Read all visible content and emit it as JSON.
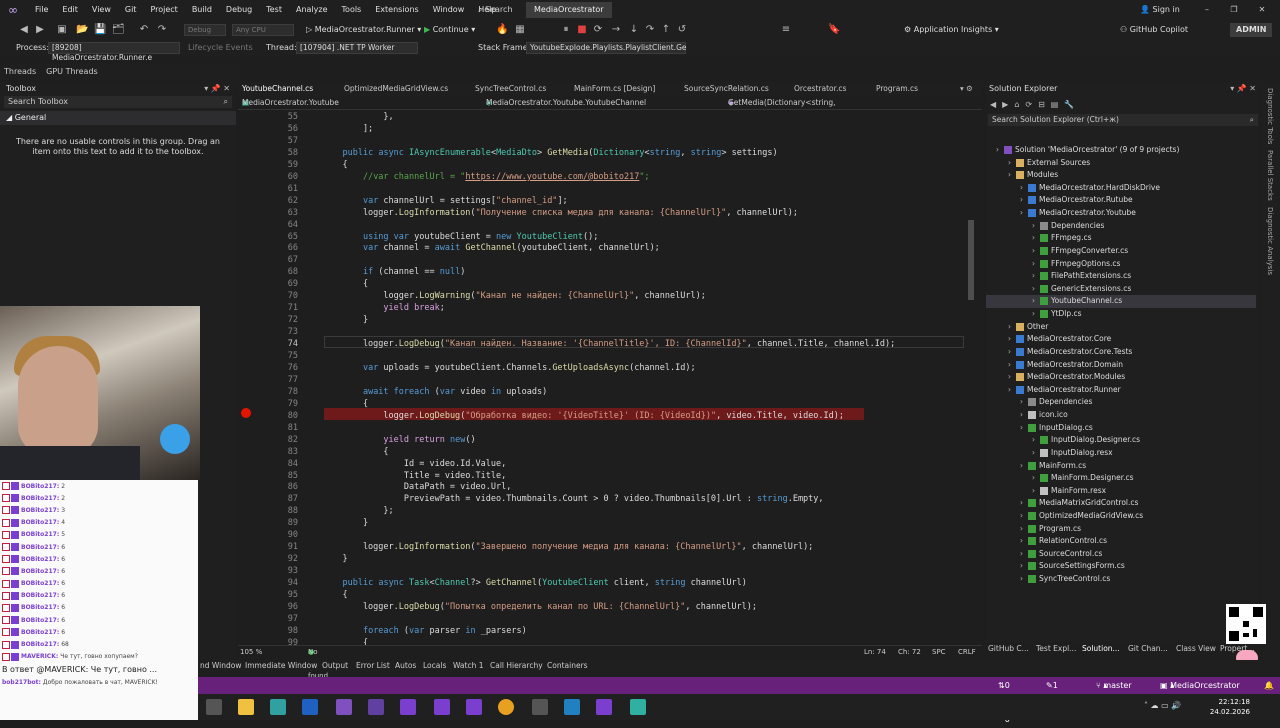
{
  "menu": {
    "items": [
      "File",
      "Edit",
      "View",
      "Git",
      "Project",
      "Build",
      "Debug",
      "Test",
      "Analyze",
      "Tools",
      "Extensions",
      "Window",
      "Help"
    ],
    "search": "Search",
    "project": "MediaOrcestrator",
    "sign_in": "Sign in"
  },
  "toolbar": {
    "config": "Debug",
    "platform": "Any CPU",
    "startup": "MediaOrcestrator.Runner",
    "continue": "Continue",
    "insights": "Application Insights",
    "copilot": "GitHub Copilot",
    "admin": "ADMIN"
  },
  "debugbar": {
    "process_label": "Process:",
    "process": "[89208] MediaOrcestrator.Runner.e",
    "lifecycle": "Lifecycle Events",
    "thread_label": "Thread:",
    "thread": "[107904] .NET TP Worker",
    "stack_label": "Stack Frame:",
    "stack": "YoutubeExplode.Playlists.PlaylistClient.Ge"
  },
  "threads": [
    "Threads",
    "GPU Threads"
  ],
  "toolbox": {
    "title": "Toolbox",
    "search": "Search Toolbox",
    "group": "General",
    "message": "There are no usable controls in this group. Drag an item onto this text to add it to the toolbox."
  },
  "chat": {
    "messages": [
      {
        "user": "BOBito217:",
        "text": "2"
      },
      {
        "user": "BOBito217:",
        "text": "2"
      },
      {
        "user": "BOBito217:",
        "text": "3"
      },
      {
        "user": "BOBito217:",
        "text": "4"
      },
      {
        "user": "BOBito217:",
        "text": "5"
      },
      {
        "user": "BOBito217:",
        "text": "6"
      },
      {
        "user": "BOBito217:",
        "text": "6"
      },
      {
        "user": "BOBito217:",
        "text": "6"
      },
      {
        "user": "BOBito217:",
        "text": "6"
      },
      {
        "user": "BOBito217:",
        "text": "6"
      },
      {
        "user": "BOBito217:",
        "text": "6"
      },
      {
        "user": "BOBito217:",
        "text": "6"
      },
      {
        "user": "BOBito217:",
        "text": "6"
      },
      {
        "user": "BOBito217:",
        "text": "68"
      },
      {
        "user": "MAVERICK:",
        "text": "Че тут, говно хопупаем?"
      }
    ],
    "reply": "В ответ @MAVERICK: Че тут, говно ...",
    "bot_user": "bob217bot:",
    "bot_text": "Добро пожаловать в чат, MAVERICK!"
  },
  "tabs": [
    "YoutubeChannel.cs",
    "OptimizedMediaGridView.cs",
    "SyncTreeControl.cs",
    "MainForm.cs [Design]",
    "SourceSyncRelation.cs",
    "Orcestrator.cs",
    "Program.cs"
  ],
  "navbar": {
    "project": "MediaOrcestrator.Youtube",
    "class": "MediaOrcestrator.Youtube.YoutubeChannel",
    "member": "GetMedia(Dictionary<string, string> settings)"
  },
  "code": [
    {
      "n": "55",
      "t": "            },"
    },
    {
      "n": "56",
      "t": "        ];"
    },
    {
      "n": "57",
      "t": ""
    },
    {
      "n": "58",
      "t": "    public async IAsyncEnumerable<MediaDto> GetMedia(Dictionary<string, string> settings)"
    },
    {
      "n": "59",
      "t": "    {"
    },
    {
      "n": "60",
      "t": "        //var channelUrl = \"https://www.youtube.com/@bobito217\";"
    },
    {
      "n": "61",
      "t": ""
    },
    {
      "n": "62",
      "t": "        var channelUrl = settings[\"channel_id\"];"
    },
    {
      "n": "63",
      "t": "        logger.LogInformation(\"Получение списка медиа для канала: {ChannelUrl}\", channelUrl);"
    },
    {
      "n": "64",
      "t": ""
    },
    {
      "n": "65",
      "t": "        using var youtubeClient = new YoutubeClient();"
    },
    {
      "n": "66",
      "t": "        var channel = await GetChannel(youtubeClient, channelUrl);"
    },
    {
      "n": "67",
      "t": ""
    },
    {
      "n": "68",
      "t": "        if (channel == null)"
    },
    {
      "n": "69",
      "t": "        {"
    },
    {
      "n": "70",
      "t": "            logger.LogWarning(\"Канал не найден: {ChannelUrl}\", channelUrl);"
    },
    {
      "n": "71",
      "t": "            yield break;"
    },
    {
      "n": "72",
      "t": "        }"
    },
    {
      "n": "73",
      "t": ""
    },
    {
      "n": "74",
      "t": "        logger.LogDebug(\"Канал найден. Название: '{ChannelTitle}', ID: {ChannelId}\", channel.Title, channel.Id);"
    },
    {
      "n": "75",
      "t": ""
    },
    {
      "n": "76",
      "t": "        var uploads = youtubeClient.Channels.GetUploadsAsync(channel.Id);"
    },
    {
      "n": "77",
      "t": ""
    },
    {
      "n": "78",
      "t": "        await foreach (var video in uploads)"
    },
    {
      "n": "79",
      "t": "        {"
    },
    {
      "n": "80",
      "t": "            logger.LogDebug(\"Обработка видео: '{VideoTitle}' (ID: {VideoId})\", video.Title, video.Id);"
    },
    {
      "n": "81",
      "t": ""
    },
    {
      "n": "82",
      "t": "            yield return new()"
    },
    {
      "n": "83",
      "t": "            {"
    },
    {
      "n": "84",
      "t": "                Id = video.Id.Value,"
    },
    {
      "n": "85",
      "t": "                Title = video.Title,"
    },
    {
      "n": "86",
      "t": "                DataPath = video.Url,"
    },
    {
      "n": "87",
      "t": "                PreviewPath = video.Thumbnails.Count > 0 ? video.Thumbnails[0].Url : string.Empty,"
    },
    {
      "n": "88",
      "t": "            };"
    },
    {
      "n": "89",
      "t": "        }"
    },
    {
      "n": "90",
      "t": ""
    },
    {
      "n": "91",
      "t": "        logger.LogInformation(\"Завершено получение медиа для канала: {ChannelUrl}\", channelUrl);"
    },
    {
      "n": "92",
      "t": "    }"
    },
    {
      "n": "93",
      "t": ""
    },
    {
      "n": "94",
      "t": "    public async Task<Channel?> GetChannel(YoutubeClient client, string channelUrl)"
    },
    {
      "n": "95",
      "t": "    {"
    },
    {
      "n": "96",
      "t": "        logger.LogDebug(\"Попытка определить канал по URL: {ChannelUrl}\", channelUrl);"
    },
    {
      "n": "97",
      "t": ""
    },
    {
      "n": "98",
      "t": "        foreach (var parser in _parsers)"
    },
    {
      "n": "99",
      "t": "        {"
    }
  ],
  "editor_status": {
    "zoom": "105 %",
    "issues": "No issues found",
    "ln": "Ln: 74",
    "ch": "Ch: 72",
    "spc": "SPC",
    "crlf": "CRLF"
  },
  "solution": {
    "title": "Solution Explorer",
    "search": "Search Solution Explorer (Ctrl+ж)",
    "tree": [
      {
        "label": "Solution 'MediaOrcestrator' (9 of 9 projects)",
        "d": 0,
        "sel": false
      },
      {
        "label": "External Sources",
        "d": 1,
        "sel": false
      },
      {
        "label": "Modules",
        "d": 1,
        "sel": false
      },
      {
        "label": "MediaOrcestrator.HardDiskDrive",
        "d": 2,
        "sel": false
      },
      {
        "label": "MediaOrcestrator.Rutube",
        "d": 2,
        "sel": false
      },
      {
        "label": "MediaOrcestrator.Youtube",
        "d": 2,
        "sel": false
      },
      {
        "label": "Dependencies",
        "d": 3,
        "sel": false
      },
      {
        "label": "FFmpeg.cs",
        "d": 3,
        "sel": false
      },
      {
        "label": "FFmpegConverter.cs",
        "d": 3,
        "sel": false
      },
      {
        "label": "FFmpegOptions.cs",
        "d": 3,
        "sel": false
      },
      {
        "label": "FilePathExtensions.cs",
        "d": 3,
        "sel": false
      },
      {
        "label": "GenericExtensions.cs",
        "d": 3,
        "sel": false
      },
      {
        "label": "YoutubeChannel.cs",
        "d": 3,
        "sel": true
      },
      {
        "label": "YtDlp.cs",
        "d": 3,
        "sel": false
      },
      {
        "label": "Other",
        "d": 1,
        "sel": false
      },
      {
        "label": "MediaOrcestrator.Core",
        "d": 1,
        "sel": false
      },
      {
        "label": "MediaOrcestrator.Core.Tests",
        "d": 1,
        "sel": false
      },
      {
        "label": "MediaOrcestrator.Domain",
        "d": 1,
        "sel": false
      },
      {
        "label": "MediaOrcestrator.Modules",
        "d": 1,
        "sel": false
      },
      {
        "label": "MediaOrcestrator.Runner",
        "d": 1,
        "sel": false
      },
      {
        "label": "Dependencies",
        "d": 2,
        "sel": false
      },
      {
        "label": "icon.ico",
        "d": 2,
        "sel": false
      },
      {
        "label": "InputDialog.cs",
        "d": 2,
        "sel": false
      },
      {
        "label": "InputDialog.Designer.cs",
        "d": 3,
        "sel": false
      },
      {
        "label": "InputDialog.resx",
        "d": 3,
        "sel": false
      },
      {
        "label": "MainForm.cs",
        "d": 2,
        "sel": false
      },
      {
        "label": "MainForm.Designer.cs",
        "d": 3,
        "sel": false
      },
      {
        "label": "MainForm.resx",
        "d": 3,
        "sel": false
      },
      {
        "label": "MediaMatrixGridControl.cs",
        "d": 2,
        "sel": false
      },
      {
        "label": "OptimizedMediaGridView.cs",
        "d": 2,
        "sel": false
      },
      {
        "label": "Program.cs",
        "d": 2,
        "sel": false
      },
      {
        "label": "RelationControl.cs",
        "d": 2,
        "sel": false
      },
      {
        "label": "SourceControl.cs",
        "d": 2,
        "sel": false
      },
      {
        "label": "SourceSettingsForm.cs",
        "d": 2,
        "sel": false
      },
      {
        "label": "SyncTreeControl.cs",
        "d": 2,
        "sel": false
      }
    ]
  },
  "right_strip": [
    "Diagnostic Tools",
    "Parallel Stacks",
    "Diagnostic Analysis"
  ],
  "bottom_tabs": [
    "nd Window",
    "Immediate Window",
    "Output",
    "Error List",
    "Autos",
    "Locals",
    "Watch 1",
    "Call Hierarchy",
    "Containers"
  ],
  "right_tabs": [
    "GitHub C...",
    "Test Expl...",
    "Solution...",
    "Git Chan...",
    "Class View",
    "Propert..."
  ],
  "statusbar": {
    "errors": "0 / 0",
    "changes": "1",
    "branch": "master",
    "repo": "MediaOrcestrator"
  },
  "clock": {
    "time": "22:12:18",
    "date": "24.02.2026"
  },
  "colors": {
    "accent": "#68217a",
    "breakpoint": "#e51400"
  }
}
